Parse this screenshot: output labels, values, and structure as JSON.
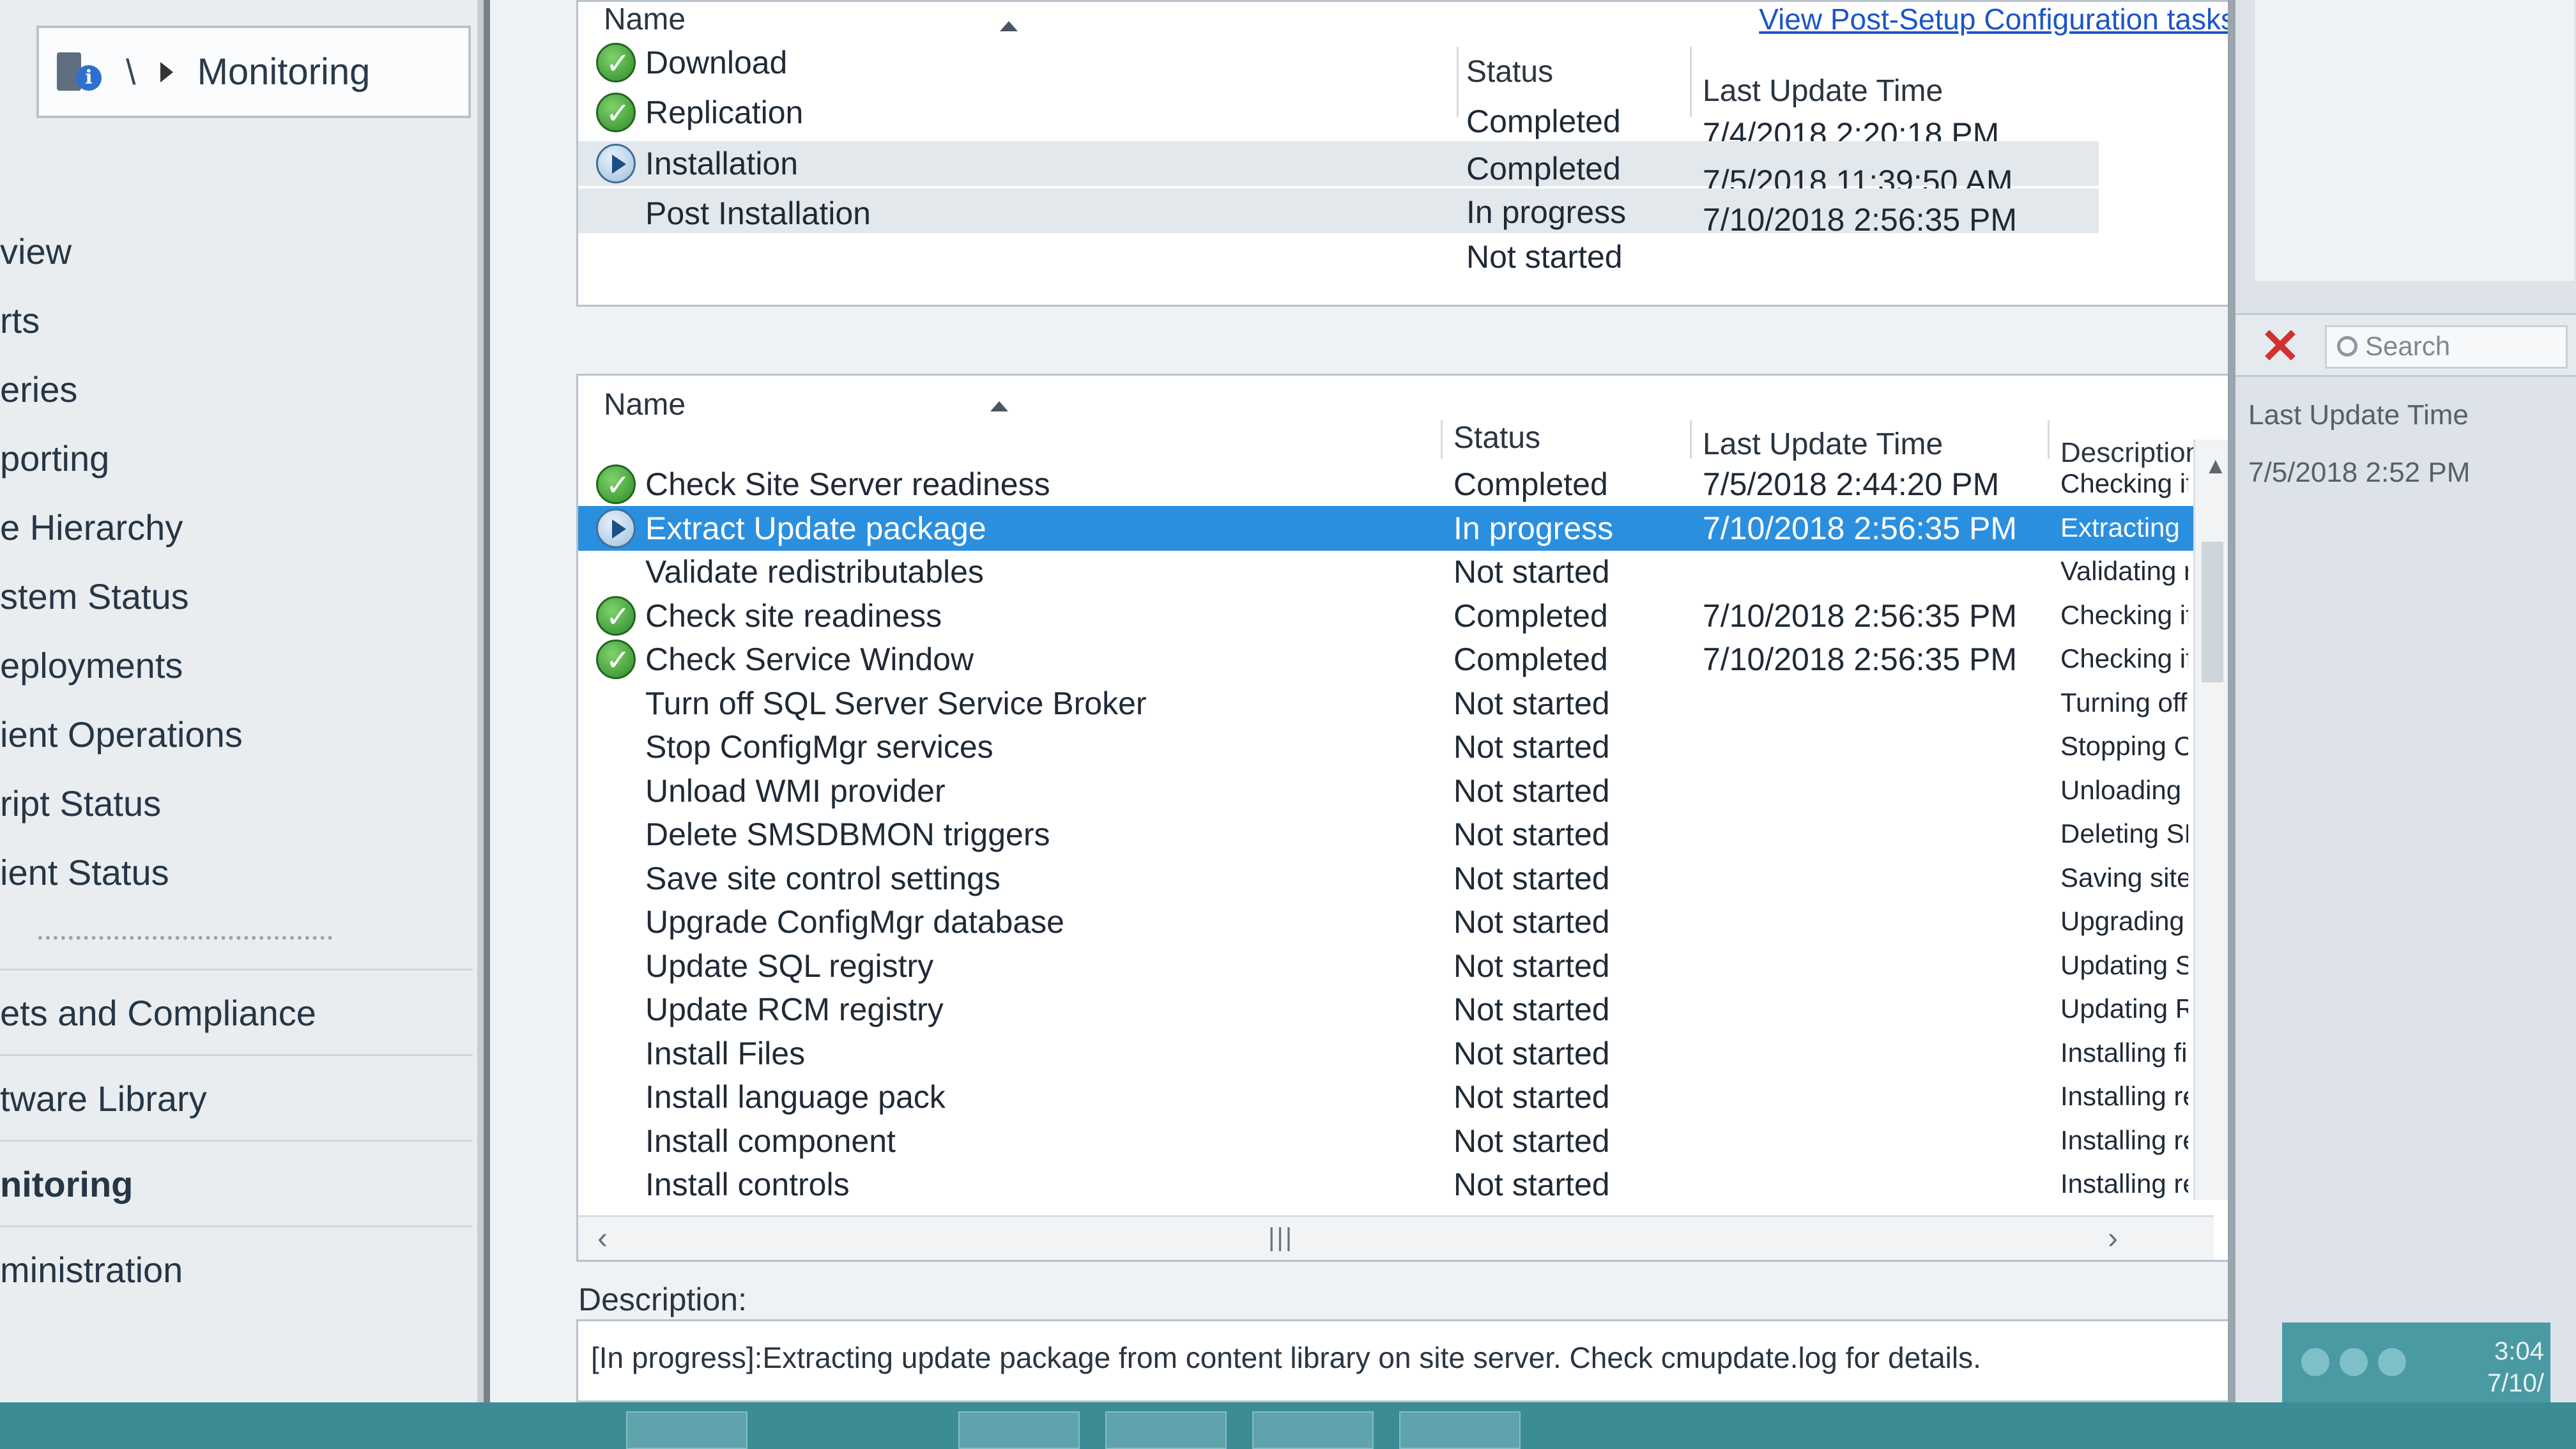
{
  "breadcrumb": {
    "separator": "\\",
    "location": "Monitoring"
  },
  "nav": {
    "items": [
      "view",
      "rts",
      "eries",
      "porting",
      "e Hierarchy",
      "stem Status",
      "eployments",
      "ient Operations",
      "ript Status",
      "ient Status"
    ],
    "workspaces": [
      "ets and Compliance",
      "tware Library",
      "nitoring",
      "ministration"
    ]
  },
  "top_panel": {
    "link": "View Post-Setup Configuration tasks",
    "headers": {
      "name": "Name",
      "status": "Status",
      "time": "Last Update Time"
    },
    "rows": [
      {
        "icon": "completed-icon",
        "name": "Download",
        "status": "Completed",
        "time": "7/4/2018 2:20:18 PM"
      },
      {
        "icon": "completed-icon",
        "name": "Replication",
        "status": "Completed",
        "time": "7/5/2018 11:39:50 AM"
      },
      {
        "icon": "in-progress-icon",
        "name": "Installation",
        "status": "In progress",
        "time": "7/10/2018 2:56:35 PM"
      },
      {
        "icon": "",
        "name": "Post Installation",
        "status": "Not started",
        "time": ""
      }
    ]
  },
  "detail_panel": {
    "headers": {
      "name": "Name",
      "status": "Status",
      "time": "Last Update Time",
      "description": "Description"
    },
    "rows": [
      {
        "icon": "completed-icon",
        "name": "Check Site Server readiness",
        "status": "Completed",
        "time": "7/5/2018 2:44:20 PM",
        "description": "Checking if Site Se"
      },
      {
        "icon": "in-progress-icon",
        "name": "Extract Update package",
        "status": "In progress",
        "time": "7/10/2018 2:56:35 PM",
        "description": "Extracting update"
      },
      {
        "icon": "",
        "name": "Validate redistributables",
        "status": "Not started",
        "time": "",
        "description": "Validating redistrib"
      },
      {
        "icon": "completed-icon",
        "name": "Check site readiness",
        "status": "Completed",
        "time": "7/10/2018 2:56:35 PM",
        "description": "Checking if CONFI"
      },
      {
        "icon": "completed-icon",
        "name": "Check Service Window",
        "status": "Completed",
        "time": "7/10/2018 2:56:35 PM",
        "description": "Checking if update"
      },
      {
        "icon": "",
        "name": "Turn off SQL Server Service Broker",
        "status": "Not started",
        "time": "",
        "description": "Turning off SQL Se"
      },
      {
        "icon": "",
        "name": "Stop ConfigMgr services",
        "status": "Not started",
        "time": "",
        "description": "Stopping ConfigMg"
      },
      {
        "icon": "",
        "name": "Unload WMI provider",
        "status": "Not started",
        "time": "",
        "description": "Unloading WMI pr"
      },
      {
        "icon": "",
        "name": "Delete SMSDBMON triggers",
        "status": "Not started",
        "time": "",
        "description": "Deleting SMSDBM"
      },
      {
        "icon": "",
        "name": "Save site control settings",
        "status": "Not started",
        "time": "",
        "description": "Saving site control"
      },
      {
        "icon": "",
        "name": "Upgrade ConfigMgr database",
        "status": "Not started",
        "time": "",
        "description": "Upgrading ConfigM"
      },
      {
        "icon": "",
        "name": "Update SQL registry",
        "status": "Not started",
        "time": "",
        "description": "Updating SQL Ser"
      },
      {
        "icon": "",
        "name": "Update RCM registry",
        "status": "Not started",
        "time": "",
        "description": "Updating RCM reg"
      },
      {
        "icon": "",
        "name": "Install Files",
        "status": "Not started",
        "time": "",
        "description": "Installing files requi"
      },
      {
        "icon": "",
        "name": "Install language pack",
        "status": "Not started",
        "time": "",
        "description": "Installing required l"
      },
      {
        "icon": "",
        "name": "Install component",
        "status": "Not started",
        "time": "",
        "description": "Installing required c"
      },
      {
        "icon": "",
        "name": "Install controls",
        "status": "Not started",
        "time": "",
        "description": "Installing required c"
      }
    ]
  },
  "description": {
    "label": "Description:",
    "text": "[In progress]:Extracting update package from content library on site server. Check cmupdate.log for details."
  },
  "right_pane": {
    "search_placeholder": "Search",
    "column": "Last Update Time",
    "value": "7/5/2018 2:52 PM"
  },
  "taskbar": {
    "clock_time": "3:04",
    "clock_date": "7/10/"
  },
  "colors": {
    "selection": "#2b8fe0",
    "completed": "#2e8a2a",
    "link": "#1a56c8",
    "taskbar": "#3c8c96"
  }
}
